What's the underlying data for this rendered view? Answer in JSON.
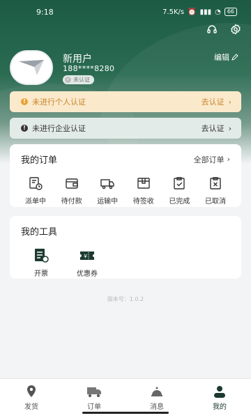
{
  "status_bar": {
    "time": "9:18",
    "network": "7.5K/s",
    "battery": "66"
  },
  "profile": {
    "name": "新用户",
    "phone": "188****8280",
    "verify_badge": "未认证",
    "edit_label": "编辑"
  },
  "banners": {
    "personal": {
      "text": "未进行个人认证",
      "action": "去认证"
    },
    "company": {
      "text": "未进行企业认证",
      "action": "去认证"
    }
  },
  "orders": {
    "title": "我的订单",
    "all_label": "全部订单",
    "items": [
      {
        "label": "派单中",
        "icon": "dispatch-icon"
      },
      {
        "label": "待付款",
        "icon": "wallet-icon"
      },
      {
        "label": "运输中",
        "icon": "truck-icon"
      },
      {
        "label": "待签收",
        "icon": "package-icon"
      },
      {
        "label": "已完成",
        "icon": "check-clipboard-icon"
      },
      {
        "label": "已取消",
        "icon": "cancel-clipboard-icon"
      }
    ]
  },
  "tools": {
    "title": "我的工具",
    "items": [
      {
        "label": "开票",
        "icon": "invoice-icon"
      },
      {
        "label": "优惠券",
        "icon": "coupon-icon"
      }
    ]
  },
  "version": "版本号：1.0.2",
  "tabbar": {
    "items": [
      {
        "label": "发货",
        "icon": "location-pin-icon"
      },
      {
        "label": "订单",
        "icon": "truck-icon"
      },
      {
        "label": "消息",
        "icon": "bell-icon"
      },
      {
        "label": "我的",
        "icon": "user-icon"
      }
    ],
    "active": "我的"
  },
  "colors": {
    "primary": "#1c5a44",
    "warning_bg": "#fbe9cc",
    "warning_text": "#c7852b",
    "info_bg": "#e3ebe8",
    "background": "#f3f4f6"
  }
}
